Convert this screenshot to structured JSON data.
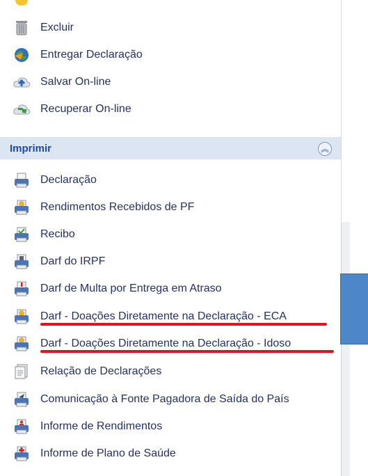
{
  "actions": [
    {
      "label": "Excluir",
      "icon": "trash-icon"
    },
    {
      "label": "Entregar Declaração",
      "icon": "globe-send-icon"
    },
    {
      "label": "Salvar On-line",
      "icon": "cloud-upload-icon"
    },
    {
      "label": "Recuperar On-line",
      "icon": "cloud-download-icon"
    }
  ],
  "print_section": {
    "title": "Imprimir",
    "collapse_icon": "double-chevron-up-icon",
    "items": [
      {
        "label": "Declaração",
        "icon": "printer-icon"
      },
      {
        "label": "Rendimentos Recebidos de PF",
        "icon": "printer-coin-icon"
      },
      {
        "label": "Recibo",
        "icon": "printer-check-icon"
      },
      {
        "label": "Darf do IRPF",
        "icon": "printer-doc-icon"
      },
      {
        "label": "Darf de Multa por Entrega em Atraso",
        "icon": "printer-alert-icon"
      },
      {
        "label": "Darf - Doações Diretamente na Declaração - ECA",
        "icon": "printer-coin-icon"
      },
      {
        "label": "Darf - Doações Diretamente na Declaração - Idoso",
        "icon": "printer-coin-icon"
      },
      {
        "label": "Relação de Declarações",
        "icon": "document-stack-icon"
      },
      {
        "label": "Comunicação à Fonte Pagadora de Saída do País",
        "icon": "printer-plane-icon"
      },
      {
        "label": "Informe de Rendimentos",
        "icon": "printer-person-icon"
      },
      {
        "label": "Informe de Plano de Saúde",
        "icon": "printer-cross-icon"
      }
    ]
  },
  "colors": {
    "section_bg": "#dce6f3",
    "annotation_red": "#e0141e",
    "blue_box": "#4d86c9"
  }
}
